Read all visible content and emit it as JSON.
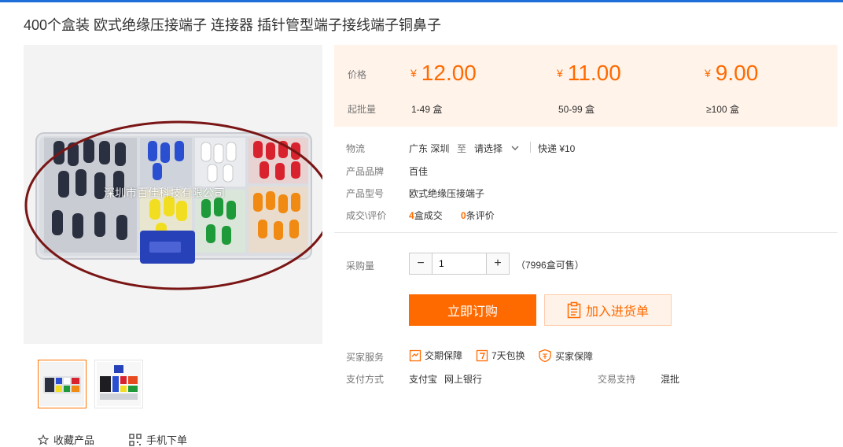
{
  "product": {
    "title": "400个盒装 欧式绝缘压接端子 连接器 插针管型端子接线端子铜鼻子",
    "watermark": "深圳市百佳科技有限公司"
  },
  "pricing": {
    "price_label": "价格",
    "moq_label": "起批量",
    "currency": "¥",
    "tiers": [
      {
        "price": "12.00",
        "qty": "1-49 盒"
      },
      {
        "price": "11.00",
        "qty": "50-99 盒"
      },
      {
        "price": "9.00",
        "qty": "≥100 盒"
      }
    ]
  },
  "logistics": {
    "label": "物流",
    "from": "广东 深圳",
    "to_word": "至",
    "select_placeholder": "请选择",
    "express": "快递 ¥10"
  },
  "attributes": [
    {
      "key": "产品品牌",
      "value": "百佳"
    },
    {
      "key": "产品型号",
      "value": "欧式绝缘压接端子"
    }
  ],
  "deals": {
    "label": "成交\\评价",
    "sold_count": "4",
    "sold_suffix": "盒成交",
    "review_count": "0",
    "review_suffix": "条评价"
  },
  "purchase": {
    "label": "采购量",
    "quantity": "1",
    "stock": "（7996盒可售）",
    "buy_now": "立即订购",
    "add_to_list": "加入进货单"
  },
  "services": {
    "label": "买家服务",
    "items": [
      "交期保障",
      "7天包换",
      "买家保障"
    ]
  },
  "payment": {
    "label": "支付方式",
    "methods": [
      "支付宝",
      "网上银行"
    ],
    "trade_label": "交易支持",
    "trade_value": "混批"
  },
  "actions": {
    "favorite": "收藏产品",
    "mobile_order": "手机下单"
  },
  "colors": {
    "accent": "#ff6a00",
    "price_bg": "#fff3ea",
    "top_bar": "#1e6fd9"
  }
}
